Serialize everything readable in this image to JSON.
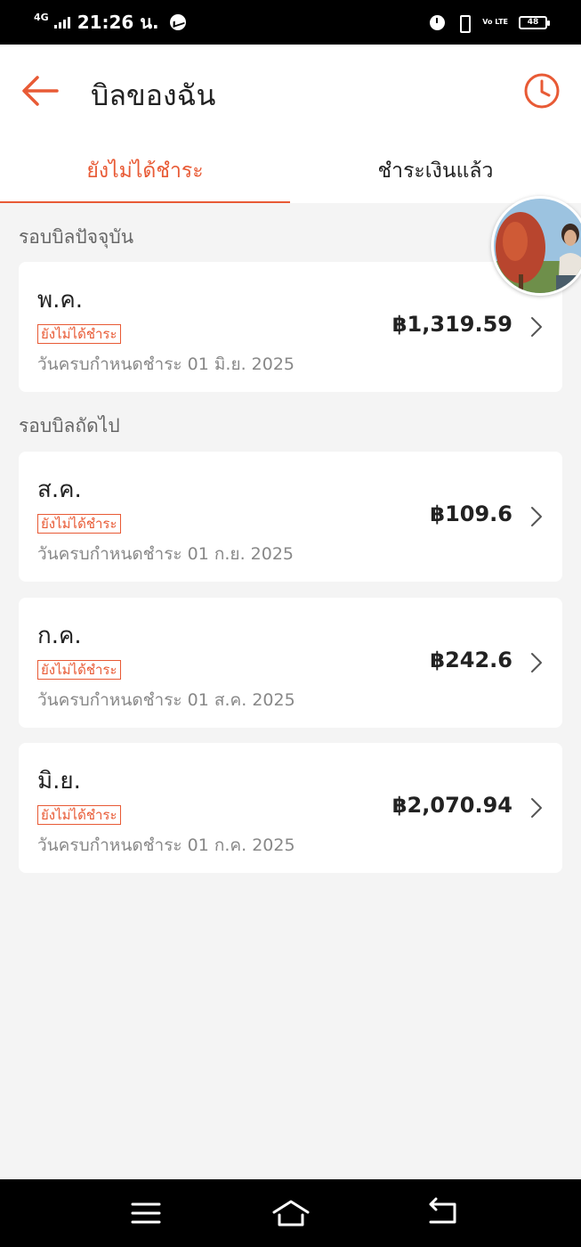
{
  "status_bar": {
    "network": "4G",
    "time": "21:26 น.",
    "volte": "Vo LTE",
    "battery": "48"
  },
  "header": {
    "title": "บิลของฉัน"
  },
  "tabs": {
    "unpaid": "ยังไม่ได้ชำระ",
    "paid": "ชำระเงินแล้ว"
  },
  "current_cycle": {
    "label": "รอบบิลปัจจุบัน",
    "bill": {
      "month": "พ.ค.",
      "status": "ยังไม่ได้ชำระ",
      "due": "วันครบกำหนดชำระ 01 มิ.ย. 2025",
      "amount": "฿1,319.59"
    }
  },
  "next_cycle": {
    "label": "รอบบิลถัดไป",
    "bills": [
      {
        "month": "ส.ค.",
        "status": "ยังไม่ได้ชำระ",
        "due": "วันครบกำหนดชำระ 01 ก.ย. 2025",
        "amount": "฿109.6"
      },
      {
        "month": "ก.ค.",
        "status": "ยังไม่ได้ชำระ",
        "due": "วันครบกำหนดชำระ 01 ส.ค. 2025",
        "amount": "฿242.6"
      },
      {
        "month": "มิ.ย.",
        "status": "ยังไม่ได้ชำระ",
        "due": "วันครบกำหนดชำระ 01 ก.ค. 2025",
        "amount": "฿2,070.94"
      }
    ]
  },
  "colors": {
    "accent": "#e85a35",
    "background": "#f4f4f4",
    "text": "#222222",
    "muted": "#888888"
  },
  "icons": {
    "back": "arrow-left-icon",
    "history": "clock-icon",
    "chevron": "chevron-right-icon",
    "nav_menu": "menu-icon",
    "nav_home": "home-icon",
    "nav_back": "back-icon"
  }
}
